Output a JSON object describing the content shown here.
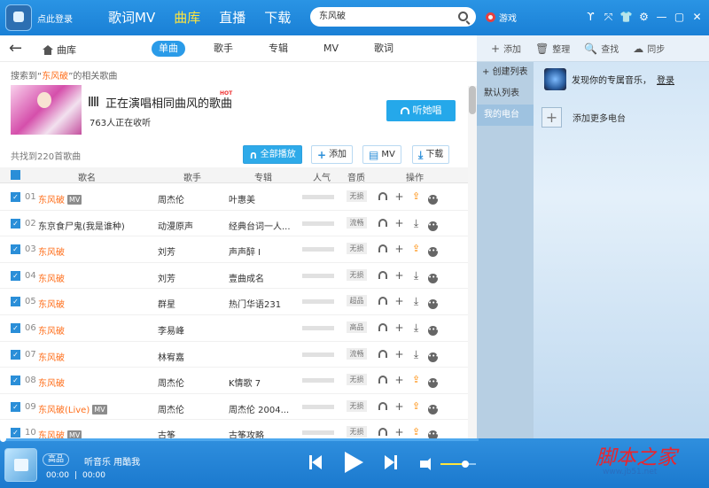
{
  "topbar": {
    "login_label": "点此登录",
    "nav": [
      {
        "label": "歌词MV",
        "active": false
      },
      {
        "label": "曲库",
        "active": true
      },
      {
        "label": "直播",
        "active": false
      },
      {
        "label": "下载",
        "active": false
      }
    ],
    "search_value": "东风破",
    "game_label": "游戏",
    "window_icons": [
      "ϒ",
      "⤧",
      "👕",
      "⚙",
      "—",
      "▢",
      "✕"
    ]
  },
  "library": {
    "breadcrumb": "曲库",
    "tabs": [
      {
        "label": "单曲",
        "active": true
      },
      {
        "label": "歌手",
        "active": false
      },
      {
        "label": "专辑",
        "active": false
      },
      {
        "label": "MV",
        "active": false
      },
      {
        "label": "歌词",
        "active": false
      }
    ],
    "result_prefix": "搜索到“",
    "result_keyword": "东风破",
    "result_suffix": "”的相关歌曲",
    "banner": {
      "title": "正在演唱相同曲风的歌曲",
      "hot": "HOT",
      "listeners": "763人正在收听",
      "button": "听她唱"
    },
    "found_count": "共找到220首歌曲",
    "actions": {
      "play_all": "全部播放",
      "add": "添加",
      "mv": "MV",
      "download": "下载"
    },
    "columns": {
      "name": "歌名",
      "singer": "歌手",
      "album": "专辑",
      "popularity": "人气",
      "quality": "音质",
      "operations": "操作"
    },
    "songs": [
      {
        "num": "01",
        "name": "东风破",
        "hl": true,
        "mv": "MV",
        "singer": "周杰伦",
        "album": "叶惠美",
        "quality": "无损",
        "share": true
      },
      {
        "num": "02",
        "name": "东京食尸鬼(我是谁种)",
        "hl": false,
        "mv": "",
        "singer": "动漫原声",
        "album": "经典台词一人...",
        "quality": "流畅",
        "share": false
      },
      {
        "num": "03",
        "name": "东风破",
        "hl": true,
        "mv": "",
        "singer": "刘芳",
        "album": "声声醉 I",
        "quality": "无损",
        "share": true
      },
      {
        "num": "04",
        "name": "东风破",
        "hl": true,
        "mv": "",
        "singer": "刘芳",
        "album": "壹曲成名",
        "quality": "无损",
        "share": false
      },
      {
        "num": "05",
        "name": "东风破",
        "hl": true,
        "mv": "",
        "singer": "群星",
        "album": "热门华语231",
        "quality": "超品",
        "share": false
      },
      {
        "num": "06",
        "name": "东风破",
        "hl": true,
        "mv": "",
        "singer": "李易峰",
        "album": "",
        "quality": "高品",
        "share": false
      },
      {
        "num": "07",
        "name": "东风破",
        "hl": true,
        "mv": "",
        "singer": "林宥嘉",
        "album": "",
        "quality": "流畅",
        "share": false
      },
      {
        "num": "08",
        "name": "东风破",
        "hl": true,
        "mv": "",
        "singer": "周杰伦",
        "album": "K情歌 7",
        "quality": "无损",
        "share": true
      },
      {
        "num": "09",
        "name": "东风破(Live)",
        "hl": true,
        "mv": "MV",
        "singer": "周杰伦",
        "album": "周杰伦 2004...",
        "quality": "无损",
        "share": true
      },
      {
        "num": "10",
        "name": "东风破",
        "hl": true,
        "mv": "MV",
        "singer": "古筝",
        "album": "古筝攻略",
        "quality": "无损",
        "share": true
      }
    ]
  },
  "radio": {
    "tools": [
      {
        "icon": "+",
        "label": "添加"
      },
      {
        "icon": "🗑",
        "label": "整理"
      },
      {
        "icon": "🔍",
        "label": "查找"
      },
      {
        "icon": "☁",
        "label": "同步"
      }
    ],
    "lists": [
      {
        "label": "+ 创建列表",
        "selected": false
      },
      {
        "label": "默认列表",
        "selected": false
      },
      {
        "label": "我的电台",
        "selected": true
      }
    ],
    "discover_text": "发现你的专属音乐，",
    "login_link": "登录",
    "add_more": "添加更多电台"
  },
  "player": {
    "quality": "高品",
    "now_playing": "听音乐 用酷我",
    "elapsed": "00:00",
    "duration": "00:00",
    "volume_fraction": 0.7
  },
  "watermark": {
    "text": "脚本之家",
    "site": "www.jb51.net"
  },
  "colors": {
    "accent": "#2a9be8",
    "highlight": "#ff6e1a",
    "nav_active": "#ffe53d"
  }
}
